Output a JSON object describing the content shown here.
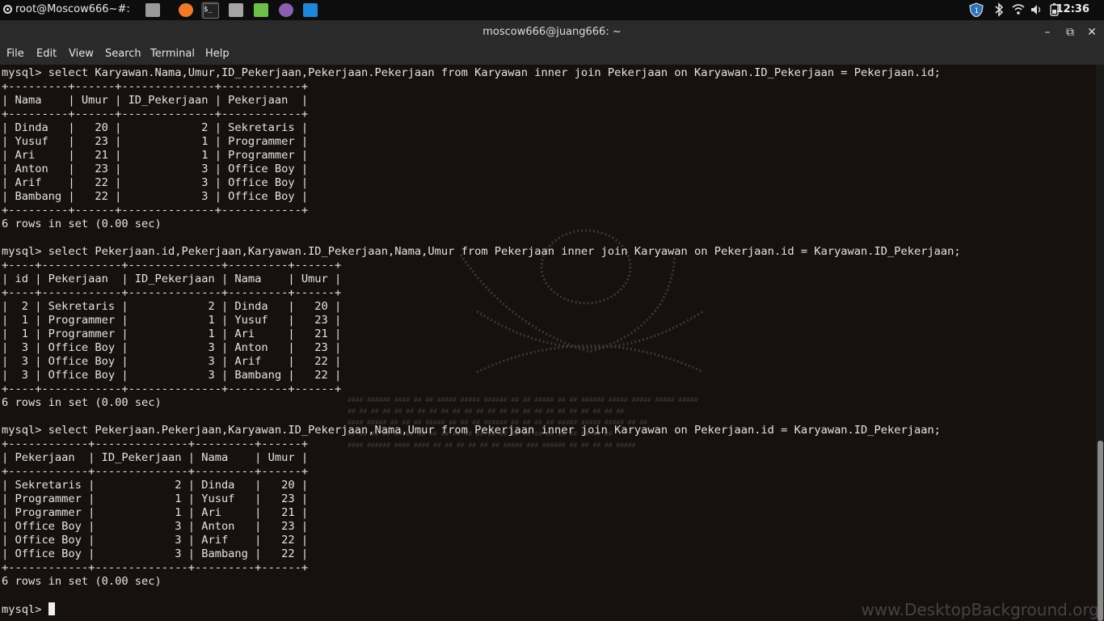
{
  "panel": {
    "title": "root@Moscow666~#:",
    "clock": "12:36",
    "tray_icons": [
      "shield-icon",
      "bluetooth-icon",
      "wifi-icon",
      "volume-icon",
      "battery-icon"
    ],
    "launchers": [
      "files-window-icon",
      "firefox-icon",
      "terminal-icon",
      "folder-icon",
      "calculator-icon",
      "screenshot-icon",
      "vscode-icon"
    ]
  },
  "window": {
    "title": "moscow666@juang666: ~",
    "controls": {
      "minimize": "–",
      "maximize": "⧉",
      "close": "✕"
    }
  },
  "menu": [
    "File",
    "Edit",
    "View",
    "Search",
    "Terminal",
    "Help"
  ],
  "terminal": {
    "lines": [
      "mysql> select Karyawan.Nama,Umur,ID_Pekerjaan,Pekerjaan.Pekerjaan from Karyawan inner join Pekerjaan on Karyawan.ID_Pekerjaan = Pekerjaan.id;",
      "+---------+------+--------------+------------+",
      "| Nama    | Umur | ID_Pekerjaan | Pekerjaan  |",
      "+---------+------+--------------+------------+",
      "| Dinda   |   20 |            2 | Sekretaris |",
      "| Yusuf   |   23 |            1 | Programmer |",
      "| Ari     |   21 |            1 | Programmer |",
      "| Anton   |   23 |            3 | Office Boy |",
      "| Arif    |   22 |            3 | Office Boy |",
      "| Bambang |   22 |            3 | Office Boy |",
      "+---------+------+--------------+------------+",
      "6 rows in set (0.00 sec)",
      "",
      "mysql> select Pekerjaan.id,Pekerjaan,Karyawan.ID_Pekerjaan,Nama,Umur from Pekerjaan inner join Karyawan on Pekerjaan.id = Karyawan.ID_Pekerjaan;",
      "+----+------------+--------------+---------+------+",
      "| id | Pekerjaan  | ID_Pekerjaan | Nama    | Umur |",
      "+----+------------+--------------+---------+------+",
      "|  2 | Sekretaris |            2 | Dinda   |   20 |",
      "|  1 | Programmer |            1 | Yusuf   |   23 |",
      "|  1 | Programmer |            1 | Ari     |   21 |",
      "|  3 | Office Boy |            3 | Anton   |   23 |",
      "|  3 | Office Boy |            3 | Arif    |   22 |",
      "|  3 | Office Boy |            3 | Bambang |   22 |",
      "+----+------------+--------------+---------+------+",
      "6 rows in set (0.00 sec)",
      "",
      "mysql> select Pekerjaan.Pekerjaan,Karyawan.ID_Pekerjaan,Nama,Umur from Pekerjaan inner join Karyawan on Pekerjaan.id = Karyawan.ID_Pekerjaan;",
      "+------------+--------------+---------+------+",
      "| Pekerjaan  | ID_Pekerjaan | Nama    | Umur |",
      "+------------+--------------+---------+------+",
      "| Sekretaris |            2 | Dinda   |   20 |",
      "| Programmer |            1 | Yusuf   |   23 |",
      "| Programmer |            1 | Ari     |   21 |",
      "| Office Boy |            3 | Anton   |   23 |",
      "| Office Boy |            3 | Arif    |   22 |",
      "| Office Boy |            3 | Bambang |   22 |",
      "+------------+--------------+---------+------+",
      "6 rows in set (0.00 sec)",
      ""
    ],
    "prompt": "mysql> "
  },
  "watermark": "www.DesktopBackground.org"
}
